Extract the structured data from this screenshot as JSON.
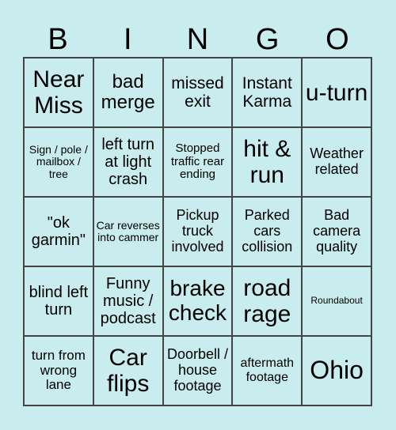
{
  "header": {
    "letters": [
      "B",
      "I",
      "N",
      "G",
      "O"
    ]
  },
  "cells": [
    {
      "text": "Near Miss",
      "size": 30
    },
    {
      "text": "bad merge",
      "size": 24
    },
    {
      "text": "missed exit",
      "size": 21
    },
    {
      "text": "Instant Karma",
      "size": 21
    },
    {
      "text": "u-turn",
      "size": 30
    },
    {
      "text": "Sign / pole / mailbox / tree",
      "size": 14
    },
    {
      "text": "left turn at light crash",
      "size": 20
    },
    {
      "text": "Stopped traffic rear ending",
      "size": 15
    },
    {
      "text": "hit & run",
      "size": 30
    },
    {
      "text": "Weather related",
      "size": 18
    },
    {
      "text": "\"ok garmin\"",
      "size": 20
    },
    {
      "text": "Car reverses into cammer",
      "size": 14
    },
    {
      "text": "Pickup truck involved",
      "size": 18
    },
    {
      "text": "Parked cars collision",
      "size": 18
    },
    {
      "text": "Bad camera quality",
      "size": 18
    },
    {
      "text": "blind left turn",
      "size": 20
    },
    {
      "text": "Funny music / podcast",
      "size": 20
    },
    {
      "text": "brake check",
      "size": 28
    },
    {
      "text": "road rage",
      "size": 30
    },
    {
      "text": "Roundabout",
      "size": 12
    },
    {
      "text": "turn from wrong lane",
      "size": 17
    },
    {
      "text": "Car flips",
      "size": 30
    },
    {
      "text": "Doorbell / house footage",
      "size": 18
    },
    {
      "text": "aftermath footage",
      "size": 16
    },
    {
      "text": "Ohio",
      "size": 32
    }
  ]
}
